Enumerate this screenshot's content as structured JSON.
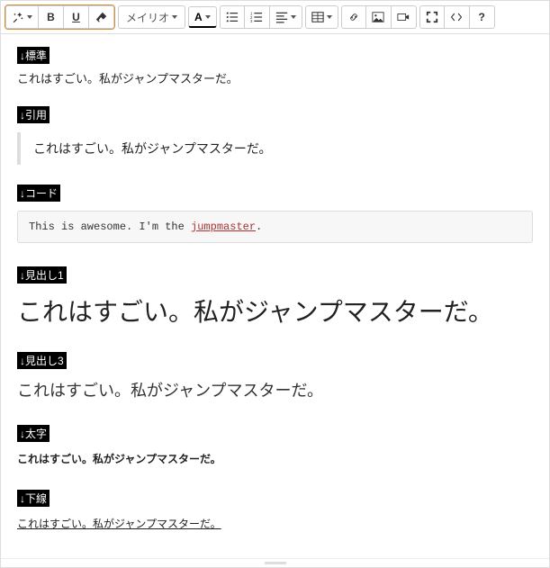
{
  "toolbar": {
    "font_family": "メイリオ",
    "bold_glyph": "B",
    "underline_glyph": "U",
    "color_glyph": "A",
    "help_glyph": "?"
  },
  "sections": {
    "standard": {
      "label": "↓標準",
      "text": "これはすごい。私がジャンプマスターだ。"
    },
    "quote": {
      "label": "↓引用",
      "text": "これはすごい。私がジャンプマスターだ。"
    },
    "code": {
      "label": "↓コード",
      "text_pre": "This is awesome. I'm the ",
      "text_jm": "jumpmaster",
      "text_post": "."
    },
    "h1": {
      "label": "↓見出し1",
      "text": "これはすごい。私がジャンプマスターだ。"
    },
    "h3": {
      "label": "↓見出し3",
      "text": "これはすごい。私がジャンプマスターだ。"
    },
    "bold": {
      "label": "↓太字",
      "text": "これはすごい。私がジャンプマスターだ。"
    },
    "underline": {
      "label": "↓下線",
      "text": "これはすごい。私がジャンプマスターだ。"
    }
  }
}
